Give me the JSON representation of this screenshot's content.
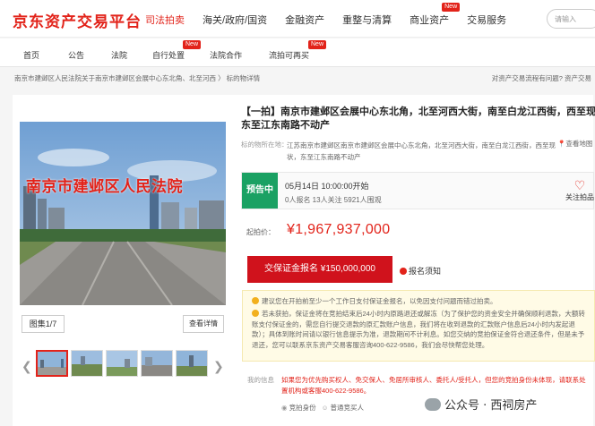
{
  "header": {
    "logo": "京东资产交易平台",
    "nav": [
      {
        "label": "司法拍卖",
        "active": true
      },
      {
        "label": "海关/政府/国资"
      },
      {
        "label": "金融资产"
      },
      {
        "label": "重整与清算"
      },
      {
        "label": "商业资产",
        "badge": "New"
      },
      {
        "label": "交易服务"
      }
    ],
    "search_placeholder": "请输入"
  },
  "subnav": [
    {
      "label": "首页"
    },
    {
      "label": "公告"
    },
    {
      "label": "法院"
    },
    {
      "label": "自行处置",
      "badge": "New"
    },
    {
      "label": "法院合作"
    },
    {
      "label": "流拍可再买",
      "badge": "New"
    }
  ],
  "breadcrumb": "南京市建邺区人民法院关于南京市建邺区会展中心东北角、北至河西 〉 标的物详情",
  "help_link": "对资产交易流程有问题? 资产交易",
  "gallery": {
    "caption": "南京市建邺区人民法院",
    "count_label": "图集1/7",
    "detail_label": "查看详情",
    "thumb_count": 5
  },
  "lot": {
    "title_line1": "【一拍】南京市建邺区会展中心东北角，北至河西大街，南至白龙江西街，西至现状，",
    "title_line2": "东至江东南路不动产",
    "address_label": "标的物所在地：",
    "address": "江苏南京市建邺区南京市建邺区会展中心东北角，北至河西大街，南至白龙江西街，西至现状，东至江东南路不动产",
    "map_link": "查看地图",
    "status": "预告中",
    "start_time": "05月14日  10:00:00开始",
    "stats": "0人报名  13人关注  5921人围观",
    "follow_label": "关注拍品",
    "price_label": "起拍价：",
    "price": "¥1,967,937,000",
    "bid_button": "交保证金报名 ¥150,000,000",
    "notice_link": "报名须知"
  },
  "tips": [
    "建议您在开拍前至少一个工作日支付保证金报名，以免因支付问题而错过拍卖。",
    "若未获拍，保证金将在竞拍结束后24小时内原路退还或解冻（为了保护您的资金安全并确保顺利退款，大额转账支付保证金的，需您自行提交退款的原汇款账户信息，我们将在收到退款的汇款账户信息后24小时内发起退款）；具体到账时间请以银行信息提示为准，退款期间不计利息。如您交纳的竞拍保证金符合退还条件，但是未予退还，您可以联系京东资产交易客服咨询400-622-9586，我们会尽快帮您处理。"
  ],
  "rules": {
    "label": "我的信息",
    "text": "如果您为优先购买权人、免交保人、免居所审核人、委托人/受托人，但您的竞拍身份未体现，请联系处置机构或客服400-622-9586。",
    "bidder_prefix": "竞拍身份",
    "bidder_value": "普通竞买人"
  },
  "watermark": "公众号 · 西祠房产"
}
